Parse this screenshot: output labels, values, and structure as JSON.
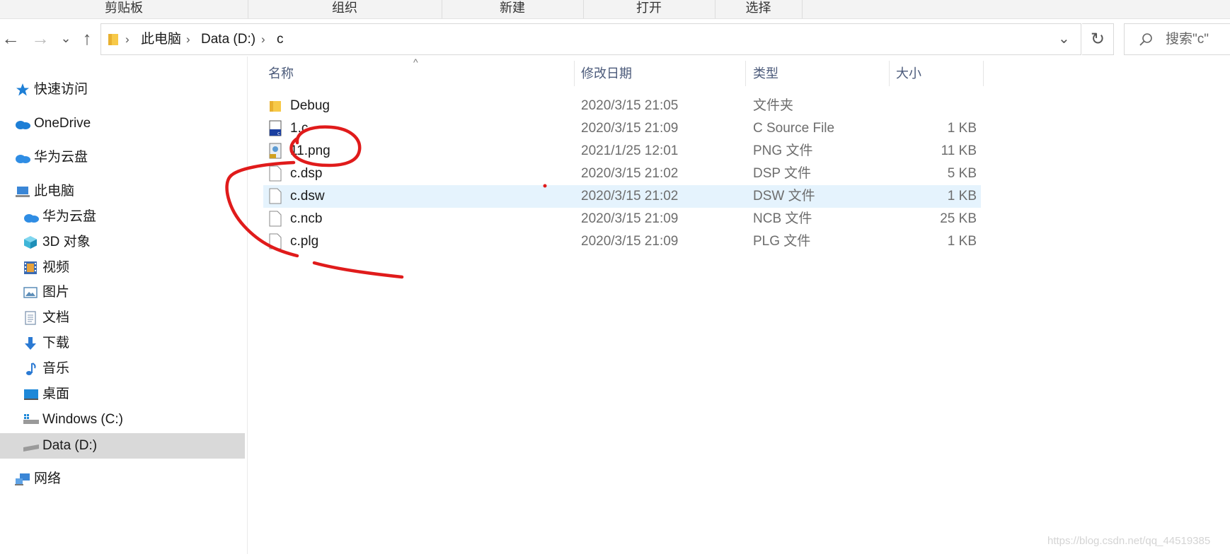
{
  "ribbon": {
    "groups": [
      "剪贴板",
      "组织",
      "新建",
      "打开",
      "选择"
    ]
  },
  "nav": {
    "back": "←",
    "forward": "→",
    "recent": "⌄",
    "up": "↑"
  },
  "address": {
    "crumbs": [
      "此电脑",
      "Data (D:)",
      "c"
    ],
    "separator": "›",
    "dropdown": "⌄",
    "refresh": "↻"
  },
  "search": {
    "placeholder": "搜索\"c\"",
    "icon": "search-icon"
  },
  "sidebar": {
    "items": [
      {
        "label": "快速访问",
        "icon": "star-icon",
        "color": "#1e7fd6"
      },
      {
        "label": "OneDrive",
        "icon": "cloud-icon",
        "color": "#1e7fd6"
      },
      {
        "label": "华为云盘",
        "icon": "cloud-icon",
        "color": "#2f8de4"
      },
      {
        "label": "此电脑",
        "icon": "computer-icon",
        "color": "#3a86d6"
      },
      {
        "label": "华为云盘",
        "icon": "cloud-icon",
        "color": "#2f8de4"
      },
      {
        "label": "3D 对象",
        "icon": "cube-icon",
        "color": "#3fb6d8"
      },
      {
        "label": "视频",
        "icon": "film-icon",
        "color": "#3b6bb3"
      },
      {
        "label": "图片",
        "icon": "picture-icon",
        "color": "#5c8db8"
      },
      {
        "label": "文档",
        "icon": "document-icon",
        "color": "#7f96b0"
      },
      {
        "label": "下载",
        "icon": "download-icon",
        "color": "#2b7ad3"
      },
      {
        "label": "音乐",
        "icon": "music-icon",
        "color": "#2b7ad3"
      },
      {
        "label": "桌面",
        "icon": "desktop-icon",
        "color": "#1e88d8"
      },
      {
        "label": "Windows (C:)",
        "icon": "drive-icon",
        "color": "#8a8a8a"
      },
      {
        "label": "Data (D:)",
        "icon": "drive-icon",
        "color": "#8a8a8a"
      },
      {
        "label": "网络",
        "icon": "network-icon",
        "color": "#3a86d6"
      }
    ]
  },
  "list": {
    "sort_indicator": "^",
    "columns": [
      "名称",
      "修改日期",
      "类型",
      "大小"
    ],
    "rows": [
      {
        "name": "Debug",
        "date": "2020/3/15 21:05",
        "type": "文件夹",
        "size": "",
        "icon": "folder-icon"
      },
      {
        "name": "1.c",
        "date": "2020/3/15 21:09",
        "type": "C Source File",
        "size": "1 KB",
        "icon": "c-source-icon"
      },
      {
        "name": "11.png",
        "date": "2021/1/25 12:01",
        "type": "PNG 文件",
        "size": "11 KB",
        "icon": "png-icon"
      },
      {
        "name": "c.dsp",
        "date": "2020/3/15 21:02",
        "type": "DSP 文件",
        "size": "5 KB",
        "icon": "file-icon"
      },
      {
        "name": "c.dsw",
        "date": "2020/3/15 21:02",
        "type": "DSW 文件",
        "size": "1 KB",
        "icon": "file-icon"
      },
      {
        "name": "c.ncb",
        "date": "2020/3/15 21:09",
        "type": "NCB 文件",
        "size": "25 KB",
        "icon": "file-icon"
      },
      {
        "name": "c.plg",
        "date": "2020/3/15 21:09",
        "type": "PLG 文件",
        "size": "1 KB",
        "icon": "file-icon"
      }
    ]
  },
  "annotation": {
    "stroke_color": "#e01b1b"
  },
  "watermark": "https://blog.csdn.net/qq_44519385"
}
